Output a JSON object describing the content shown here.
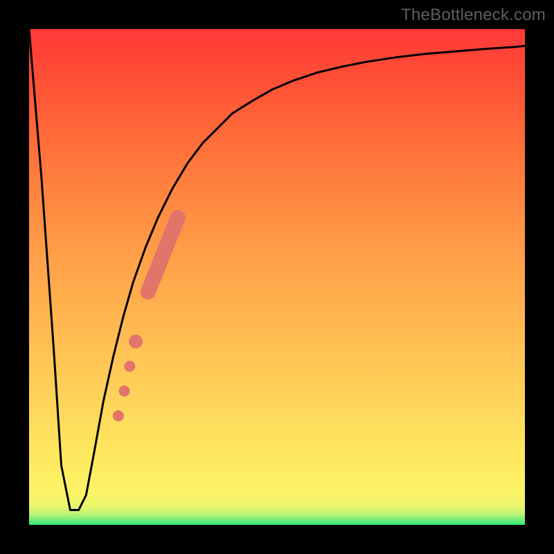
{
  "watermark": "TheBottleneck.com",
  "chart_data": {
    "type": "line",
    "title": "",
    "xlabel": "",
    "ylabel": "",
    "xlim": [
      0,
      100
    ],
    "ylim": [
      0,
      100
    ],
    "background_gradient": {
      "stops": [
        {
          "pos": 0.0,
          "color": "#2ae879"
        },
        {
          "pos": 0.06,
          "color": "#f8f566"
        },
        {
          "pos": 0.5,
          "color": "#ffa44a"
        },
        {
          "pos": 1.0,
          "color": "#ff3938"
        }
      ],
      "direction": "bottom-to-top"
    },
    "series": [
      {
        "name": "bottleneck-curve",
        "color": "#000000",
        "stroke_width": 3,
        "x": [
          0.0,
          2.5,
          5.0,
          6.5,
          8.3,
          10.0,
          11.5,
          13.0,
          15.0,
          17.0,
          19.0,
          21.0,
          23.5,
          26.0,
          29.0,
          32.0,
          35.0,
          38.0,
          41.0,
          45.0,
          49.0,
          53.0,
          58.0,
          63.0,
          68.0,
          74.0,
          80.0,
          86.0,
          92.0,
          98.0,
          100.0
        ],
        "y": [
          100.0,
          70.0,
          35.0,
          12.0,
          3.0,
          3.0,
          6.0,
          14.0,
          25.0,
          34.0,
          42.0,
          49.0,
          56.0,
          62.0,
          68.0,
          73.0,
          77.0,
          80.0,
          83.0,
          85.5,
          87.8,
          89.5,
          91.2,
          92.4,
          93.4,
          94.3,
          95.0,
          95.5,
          96.0,
          96.4,
          96.6
        ]
      }
    ],
    "highlight": {
      "name": "highlighted-segment",
      "color": "#e2746a",
      "type": "points-on-curve",
      "points": [
        {
          "x": 18.0,
          "y": 22.0,
          "r": 8
        },
        {
          "x": 19.2,
          "y": 27.0,
          "r": 8
        },
        {
          "x": 20.3,
          "y": 32.0,
          "r": 8
        },
        {
          "x": 21.5,
          "y": 37.0,
          "r": 10
        },
        {
          "x": 24.0,
          "y": 47.0,
          "r": 11,
          "segment_start": true
        },
        {
          "x": 30.0,
          "y": 62.0,
          "r": 11,
          "segment_end": true
        }
      ]
    }
  }
}
